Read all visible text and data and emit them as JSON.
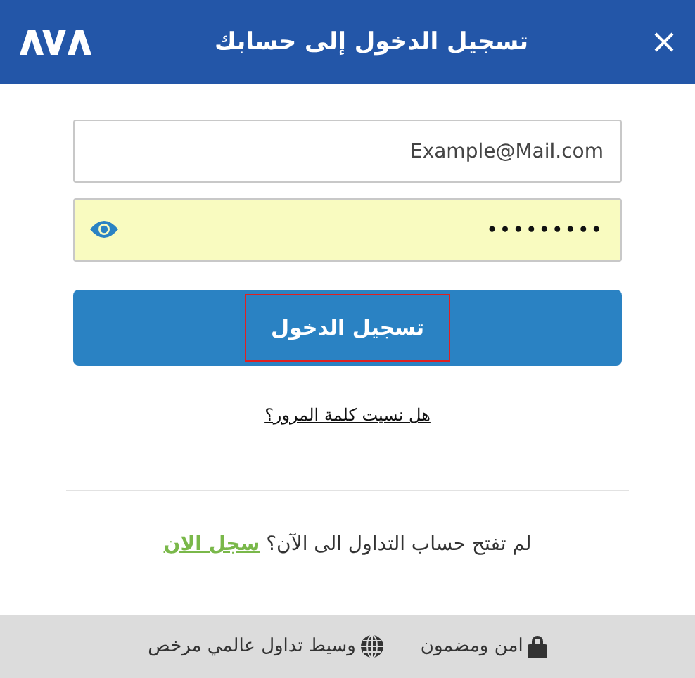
{
  "header": {
    "title": "تسجيل الدخول إلى حسابك"
  },
  "email_field": {
    "value": "Example@Mail.com"
  },
  "password_field": {
    "value": "•••••••••",
    "autofilled": true
  },
  "login_button": {
    "label": "تسجيل الدخول",
    "focused": true
  },
  "forgot_link": "هل نسيت كلمة المرور؟",
  "signup": {
    "text": "لم تفتح حساب التداول الى الآن؟",
    "link": "سجل الان"
  },
  "footer": {
    "items": [
      {
        "kind": "lock",
        "label": "امن ومضمون"
      },
      {
        "kind": "globe",
        "label": "وسيط تداول عالمي مرخص"
      }
    ]
  }
}
